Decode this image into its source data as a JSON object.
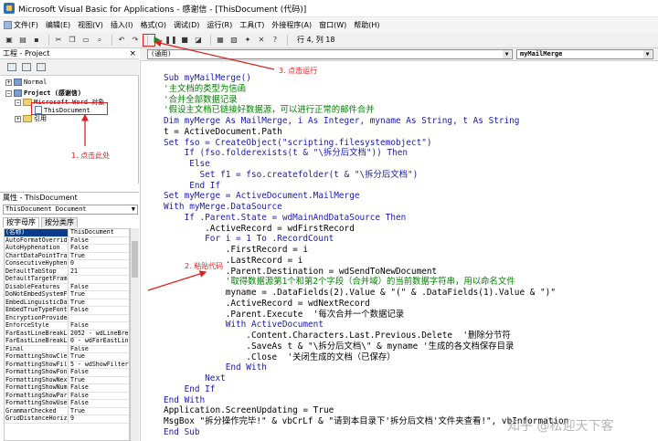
{
  "window": {
    "title": "Microsoft Visual Basic for Applications - 感谢信 - [ThisDocument (代码)]"
  },
  "menu": {
    "items": [
      "文件(F)",
      "编辑(E)",
      "视图(V)",
      "插入(I)",
      "格式(O)",
      "调试(D)",
      "运行(R)",
      "工具(T)",
      "外接程序(A)",
      "窗口(W)",
      "帮助(H)"
    ]
  },
  "toolbar": {
    "position_text": "行 4, 列 18"
  },
  "project": {
    "header": "工程 - Project",
    "close_glyph": "×",
    "tree": [
      {
        "label": "Normal",
        "expander": "+"
      },
      {
        "label": "Project (感谢信)",
        "expander": "−"
      },
      {
        "label": "Microsoft Word 对象",
        "expander": "−"
      },
      {
        "label": "ThisDocument",
        "expander": ""
      },
      {
        "label": "引用",
        "expander": "+"
      }
    ]
  },
  "properties": {
    "header": "属性 - ThisDocument",
    "object": "ThisDocument  Document",
    "tabs": [
      "按字母序",
      "按分类序"
    ],
    "rows": [
      {
        "k": "(名称)",
        "v": "ThisDocument"
      },
      {
        "k": "AutoFormatOverride",
        "v": "False"
      },
      {
        "k": "AutoHyphenation",
        "v": "False"
      },
      {
        "k": "ChartDataPointTrack",
        "v": "True"
      },
      {
        "k": "ConsecutiveHyphens",
        "v": "0"
      },
      {
        "k": "DefaultTabStop",
        "v": "21"
      },
      {
        "k": "DefaultTargetFrame",
        "v": ""
      },
      {
        "k": "DisableFeatures",
        "v": "False"
      },
      {
        "k": "DoNotEmbedSystemFonts",
        "v": "True"
      },
      {
        "k": "EmbedLinguisticData",
        "v": "True"
      },
      {
        "k": "EmbedTrueTypeFonts",
        "v": "False"
      },
      {
        "k": "EncryptionProvider",
        "v": ""
      },
      {
        "k": "EnforceStyle",
        "v": "False"
      },
      {
        "k": "FarEastLineBreakLang",
        "v": "2052 - wdLineBre"
      },
      {
        "k": "FarEastLineBreakLevel",
        "v": "0 - wdFarEastLin"
      },
      {
        "k": "Final",
        "v": "False"
      },
      {
        "k": "FormattingShowClear",
        "v": "True"
      },
      {
        "k": "FormattingShowFilter",
        "v": "5 - wdShowFilter"
      },
      {
        "k": "FormattingShowFont",
        "v": "False"
      },
      {
        "k": "FormattingShowNextLevel",
        "v": "True"
      },
      {
        "k": "FormattingShowNumbering",
        "v": "False"
      },
      {
        "k": "FormattingShowParagraph",
        "v": "False"
      },
      {
        "k": "FormattingShowUserStyle",
        "v": "False"
      },
      {
        "k": "GrammarChecked",
        "v": "True"
      },
      {
        "k": "GridDistanceHorizontal",
        "v": "9"
      }
    ]
  },
  "code": {
    "object_combo": "(通用)",
    "proc_combo": "myMailMerge",
    "lines": [
      {
        "t": "Sub myMailMerge()",
        "s": "kw"
      },
      {
        "t": "'主文档的类型为信函",
        "s": "cmt"
      },
      {
        "t": "'合并全部数据记录",
        "s": "cmt"
      },
      {
        "t": "'假设主文档已链接好数据源，可以进行正常的邮件合并",
        "s": "cmt"
      },
      {
        "t": "Dim myMerge As MailMerge, i As Integer, myname As String, t As String",
        "s": "kw"
      },
      {
        "t": "t = ActiveDocument.Path",
        "s": "mix"
      },
      {
        "t": "Set fso = CreateObject(\"scripting.filesystemobject\")",
        "s": "kw"
      },
      {
        "t": "    If (fso.folderexists(t & \"\\拆分后文档\")) Then",
        "s": "kw"
      },
      {
        "t": "     Else",
        "s": "kw"
      },
      {
        "t": "       Set f1 = fso.createfolder(t & \"\\拆分后文档\")",
        "s": "kw"
      },
      {
        "t": "     End If",
        "s": "kw"
      },
      {
        "t": "Set myMerge = ActiveDocument.MailMerge",
        "s": "kw"
      },
      {
        "t": "With myMerge.DataSource",
        "s": "kw"
      },
      {
        "t": "    If .Parent.State = wdMainAndDataSource Then",
        "s": "kw"
      },
      {
        "t": "        .ActiveRecord = wdFirstRecord",
        "s": "mix"
      },
      {
        "t": "        For i = 1 To .RecordCount",
        "s": "kw"
      },
      {
        "t": "            .FirstRecord = i",
        "s": "mix"
      },
      {
        "t": "            .LastRecord = i",
        "s": "mix"
      },
      {
        "t": "            .Parent.Destination = wdSendToNewDocument",
        "s": "mix"
      },
      {
        "t": "            '取得数据源第1个和第2个字段（合并域）的当前数据字符串，用以命名文件",
        "s": "cmt"
      },
      {
        "t": "            myname = .DataFields(2).Value & \"(\" & .DataFields(1).Value & \")\"",
        "s": "mix"
      },
      {
        "t": "            .ActiveRecord = wdNextRecord",
        "s": "mix"
      },
      {
        "t": "            .Parent.Execute  '每次合并一个数据记录",
        "s": "mix"
      },
      {
        "t": "            With ActiveDocument",
        "s": "kw"
      },
      {
        "t": "                .Content.Characters.Last.Previous.Delete  '删除分节符",
        "s": "mix"
      },
      {
        "t": "                .SaveAs t & \"\\拆分后文档\\\" & myname '生成的各文档保存目录",
        "s": "mix"
      },
      {
        "t": "                .Close  '关闭生成的文档（已保存）",
        "s": "mix"
      },
      {
        "t": "            End With",
        "s": "kw"
      },
      {
        "t": "        Next",
        "s": "kw"
      },
      {
        "t": "    End If",
        "s": "kw"
      },
      {
        "t": "End With",
        "s": "kw"
      },
      {
        "t": "Application.ScreenUpdating = True",
        "s": "mix"
      },
      {
        "t": "MsgBox \"拆分操作完毕!\" & vbCrLf & \"请到本目录下'拆分后文档'文件夹查看!\", vbInformation",
        "s": "mix"
      },
      {
        "t": "End Sub",
        "s": "kw"
      }
    ]
  },
  "annotations": {
    "step1": "1. 点击此处",
    "step2": "2. 粘贴代码",
    "step3": "3. 点击运行"
  },
  "watermark": "知乎 @松迎天下客",
  "colors": {
    "annotation": "#e02020",
    "keyword": "#1a1aa6",
    "comment": "#008000",
    "selection": "#0a3c8c"
  }
}
